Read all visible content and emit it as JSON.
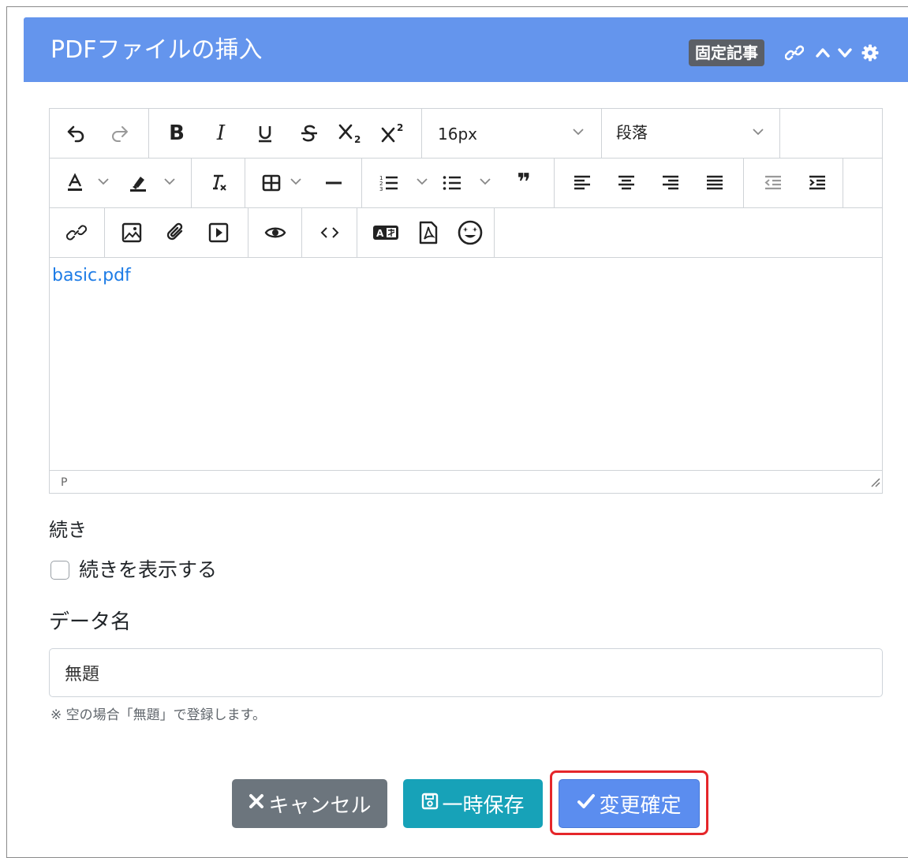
{
  "header": {
    "title": "PDFファイルの挿入",
    "badge": "固定記事",
    "icons": [
      "link-icon",
      "chevron-up-icon",
      "chevron-down-icon",
      "gear-icon"
    ],
    "background": "#6495ed"
  },
  "toolbar": {
    "font_size": "16px",
    "block_format": "段落",
    "row1": [
      "undo",
      "redo",
      "bold",
      "italic",
      "underline",
      "strikethrough",
      "subscript",
      "superscript"
    ],
    "row2": [
      "text-color",
      "highlight-color",
      "clear-format",
      "table",
      "horizontal-rule",
      "ordered-list",
      "unordered-list",
      "blockquote",
      "align-left",
      "align-center",
      "align-right",
      "align-justify",
      "outdent",
      "indent"
    ],
    "row3": [
      "link",
      "image",
      "attachment",
      "video",
      "preview",
      "source-code",
      "translate",
      "pdf",
      "emoji"
    ],
    "bold_label": "B",
    "italic_label": "I",
    "quote_label": "❞"
  },
  "editor": {
    "content_link": "basic.pdf",
    "status": "P"
  },
  "continuation": {
    "label": "続き",
    "checkbox_label": "続きを表示する",
    "checked": false
  },
  "data_name": {
    "label": "データ名",
    "value": "無題",
    "help": "※ 空の場合「無題」で登録します。"
  },
  "actions": {
    "cancel": "キャンセル",
    "temp_save": "一時保存",
    "confirm": "変更確定"
  }
}
